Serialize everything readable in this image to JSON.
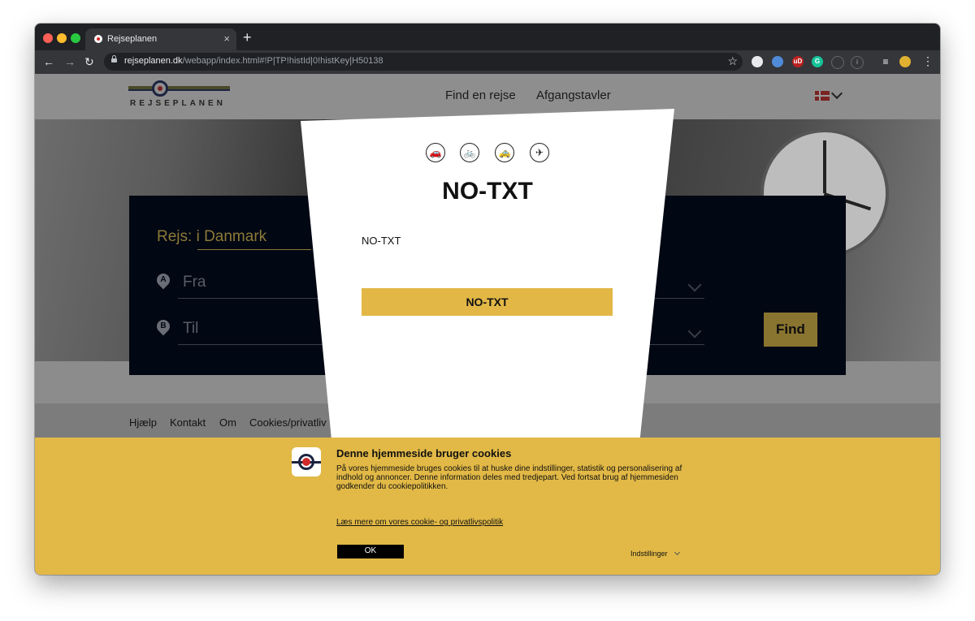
{
  "browser": {
    "tab_title": "Rejseplanen",
    "tab_close": "×",
    "new_tab": "+",
    "url_host": "rejseplanen.dk",
    "url_path": "/webapp/index.html#!P|TP!histId|0!histKey|H50138",
    "nav": {
      "back": "←",
      "forward": "→",
      "reload": "↻",
      "bookmark": "☆",
      "menu": "⋮"
    },
    "traffic_lights": [
      "#fe5f57",
      "#febc2e",
      "#28c840"
    ],
    "extensions": [
      {
        "name": "ext-icon-1",
        "color": "#e8eaed",
        "glyph": ""
      },
      {
        "name": "ext-icon-2",
        "color": "#4f8bd8",
        "glyph": ""
      },
      {
        "name": "ext-icon-ublock",
        "color": "#b22",
        "glyph": "uD"
      },
      {
        "name": "ext-icon-grammarly",
        "color": "#15c39a",
        "glyph": "G"
      },
      {
        "name": "ext-icon-5",
        "color": "#35363a",
        "glyph": ""
      },
      {
        "name": "ext-icon-6",
        "color": "#35363a",
        "glyph": "i"
      }
    ]
  },
  "site": {
    "logo_text": "REJSEPLANEN",
    "nav": {
      "find": "Find en rejse",
      "departures": "Afgangstavler"
    },
    "search": {
      "heading": "Rejs: i Danmark",
      "from_badge": "A",
      "from_label": "Fra",
      "to_badge": "B",
      "to_label": "Til",
      "find_button": "Find"
    },
    "footer": [
      "Hjælp",
      "Kontakt",
      "Om",
      "Cookies/privatliv"
    ]
  },
  "modal": {
    "icons": [
      "car-icon",
      "bicycle-icon",
      "taxi-icon",
      "airplane-icon"
    ],
    "icon_glyphs": [
      "🚗",
      "🚲",
      "🚕",
      "✈"
    ],
    "title": "NO-TXT",
    "text": "NO-TXT",
    "button": "NO-TXT",
    "accent": "#e2b746"
  },
  "cookie_banner": {
    "title": "Denne hjemmeside bruger cookies",
    "body": "På vores hjemmeside bruges cookies til at huske dine indstillinger, statistik og personalisering af indhold og annoncer. Denne information deles med tredjepart. Ved fortsat brug af hjemmesiden godkender du cookiepolitikken.",
    "link": "Læs mere om vores cookie- og privatlivspolitik",
    "ok_button": "OK",
    "settings": "Indstillinger",
    "background": "#e2b946"
  }
}
